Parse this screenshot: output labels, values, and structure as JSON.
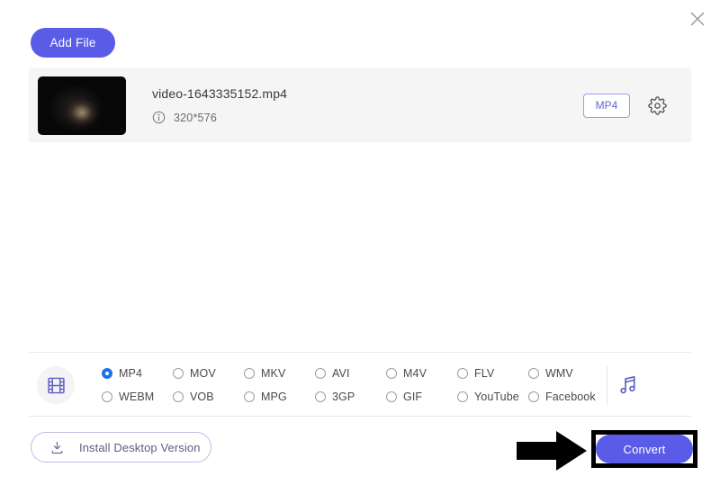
{
  "window": {
    "close_label": "×",
    "close_icon": "close-icon"
  },
  "toolbar": {
    "add_file_label": "Add File"
  },
  "file_row": {
    "name": "video-1643335152.mp4",
    "resolution": "320*576",
    "info_icon": "info-circle-icon",
    "format_badge": "MP4",
    "settings_icon": "gear-icon",
    "thumbnail_icon": "video-thumbnail"
  },
  "formats": {
    "video_icon": "film-strip-icon",
    "audio_icon": "music-note-icon",
    "selected": "MP4",
    "options": [
      {
        "label": "MP4",
        "checked": true
      },
      {
        "label": "MOV",
        "checked": false
      },
      {
        "label": "MKV",
        "checked": false
      },
      {
        "label": "AVI",
        "checked": false
      },
      {
        "label": "M4V",
        "checked": false
      },
      {
        "label": "FLV",
        "checked": false
      },
      {
        "label": "WMV",
        "checked": false
      },
      {
        "label": "WEBM",
        "checked": false
      },
      {
        "label": "VOB",
        "checked": false
      },
      {
        "label": "MPG",
        "checked": false
      },
      {
        "label": "3GP",
        "checked": false
      },
      {
        "label": "GIF",
        "checked": false
      },
      {
        "label": "YouTube",
        "checked": false
      },
      {
        "label": "Facebook",
        "checked": false
      }
    ]
  },
  "footer": {
    "install_label": "Install Desktop Version",
    "install_icon": "download-icon",
    "convert_label": "Convert"
  },
  "annotation": {
    "arrow_icon": "right-arrow-annotation",
    "highlight_target": "Convert"
  },
  "colors": {
    "accent": "#5a5ce8",
    "radio_checked": "#1a73e8",
    "row_bg": "#f5f5f5",
    "annotation": "#000000"
  }
}
